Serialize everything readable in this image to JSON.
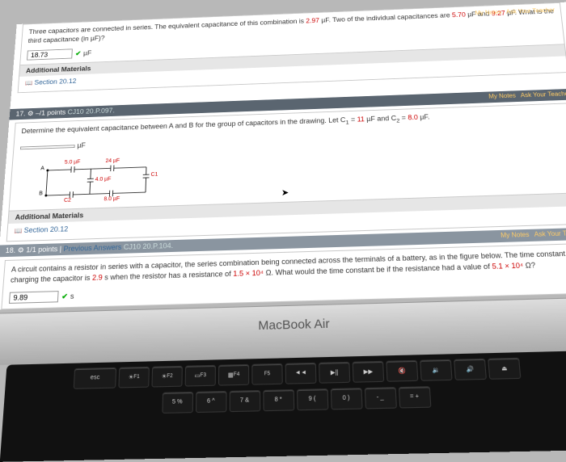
{
  "q16": {
    "text_a": "Three capacitors are connected in series. The equivalent capacitance of this combination is ",
    "v1": "2.97",
    "text_b": " µF. Two of the individual capacitances are ",
    "v2": "5.70",
    "text_c": " µF and ",
    "v3": "9.27",
    "text_d": " µF. What is the third capacitance (in µF)?",
    "ans": "18.73",
    "unit": "µF",
    "materials": "Additional Materials",
    "section": "Section 20.12"
  },
  "q17": {
    "hdr_pts": "–/1 points",
    "hdr_ref": "CJ10 20.P.097.",
    "notes": "My Notes",
    "ask": "Ask Your Teacher",
    "text_a": "Determine the equivalent capacitance between A and B for the group of capacitors in the drawing. Let C",
    "sub1": "1",
    "text_b": " = ",
    "v1": "11",
    "text_c": " µF and C",
    "sub2": "2",
    "text_d": " = ",
    "v2": "8.0",
    "text_e": " µF.",
    "unit": "µF",
    "materials": "Additional Materials",
    "section": "Section 20.12",
    "c_50": "5.0 µF",
    "c_24": "24 µF",
    "c_40": "4.0 µF",
    "c_c1": "C1",
    "c_c2": "C2",
    "c_80": "8.0 µF"
  },
  "q18": {
    "num": "18.",
    "hdr_pts": "1/1 points",
    "prev": "Previous Answers",
    "hdr_ref": "CJ10 20.P.104.",
    "notes": "My Notes",
    "ask": "Ask Your Teacher",
    "text_a": "A circuit contains a resistor in series with a capacitor, the series combination being connected across the terminals of a battery, as in the figure below. The time constant for charging the capacitor is ",
    "v1": "2.9",
    "text_b": " s when the resistor has a resistance of ",
    "v2": "1.5 × 10⁴",
    "text_c": " Ω. What would the time constant be if the resistance had a value of ",
    "v3": "5.1 × 10⁴",
    "text_d": " Ω?",
    "ans": "9.89",
    "unit": "s"
  },
  "mb": "MacBook Air",
  "keys": {
    "esc": "esc",
    "f1": "F1",
    "f2": "F2",
    "f3": "F3",
    "f4": "F4",
    "f5": "F5",
    "f6": "◄◄",
    "f7": "▶||",
    "f8": "▶▶",
    "f9": "🔇",
    "f10": "🔉",
    "f11": "🔊",
    "f12": "⏏",
    "k5": "5  %",
    "k6": "6  ^",
    "k7": "7  &",
    "k8": "8  *",
    "k9": "9  (",
    "k0": "0  )",
    "km": "-  _",
    "ke": "=  +"
  }
}
